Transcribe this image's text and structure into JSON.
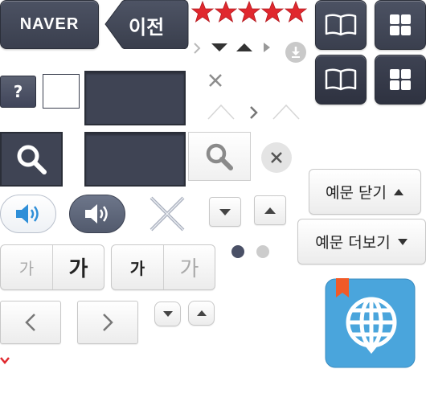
{
  "header": {
    "logo_label": "NAVER",
    "prev_label": "이전"
  },
  "rating": {
    "stars": 5,
    "star_color": "#e0282e"
  },
  "help": {
    "label": "?"
  },
  "font_size": {
    "small_label": "가",
    "large_label": "가"
  },
  "example": {
    "close_label": "예문 닫기",
    "more_label": "예문 더보기"
  },
  "colors": {
    "dark": "#3f4454",
    "accent_blue": "#2f8fd8",
    "dict_blue": "#4aa5dc",
    "bookmark": "#f05a28"
  },
  "icons": [
    "book-icon",
    "grid-icon",
    "search-icon",
    "speaker-icon",
    "close-icon",
    "download-icon",
    "chevron-left-icon",
    "chevron-right-icon",
    "triangle-up-icon",
    "triangle-down-icon",
    "globe-icon"
  ]
}
